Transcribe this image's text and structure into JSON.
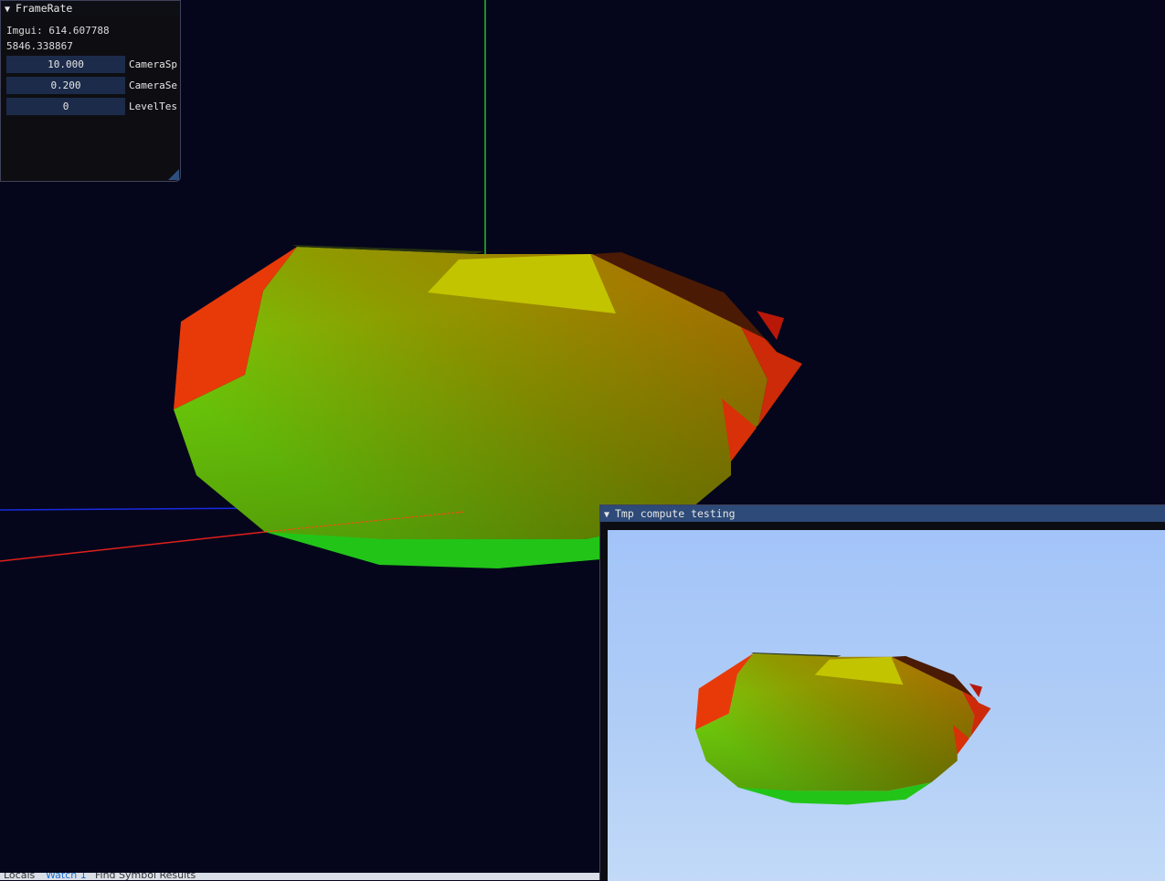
{
  "framerate_window": {
    "title": "FrameRate",
    "collapse_icon": "triangle-down-icon",
    "imgui_fps_label": "Imgui: 614.607788",
    "app_fps_value": "5846.338867",
    "fields": [
      {
        "value": "10.000",
        "label": "CameraSp"
      },
      {
        "value": "0.200",
        "label": "CameraSe"
      },
      {
        "value": "0",
        "label": "LevelTes"
      }
    ]
  },
  "compute_window": {
    "title": "Tmp compute testing",
    "collapse_icon": "triangle-down-icon"
  },
  "bottom_tabs": [
    "Locals",
    "Watch 1",
    "Find Symbol Results"
  ],
  "colors": {
    "viewport_bg": "#05061c",
    "axis_x": "#e0201a",
    "axis_y": "#22c41c",
    "axis_z": "#1a2ae0",
    "imgui_title_active": "#2d4a78",
    "imgui_field": "#1c2b4a",
    "sky_top": "#a3c4f9",
    "sky_bottom": "#c2daf8"
  }
}
